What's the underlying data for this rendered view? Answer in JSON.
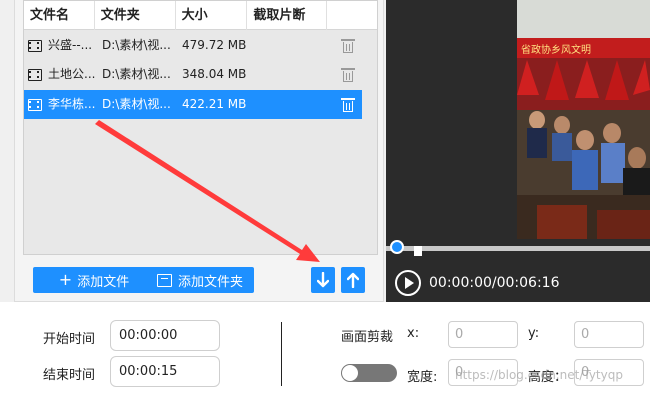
{
  "file_list": {
    "columns": [
      "文件名",
      "文件夹",
      "大小",
      "截取片断"
    ],
    "rows": [
      {
        "name": "兴盛--...",
        "folder": "D:\\素材\\视...",
        "size": "479.72 MB",
        "selected": false
      },
      {
        "name": "土地公...",
        "folder": "D:\\素材\\视...",
        "size": "348.04 MB",
        "selected": false
      },
      {
        "name": "李华栋...",
        "folder": "D:\\素材\\视...",
        "size": "422.21 MB",
        "selected": true
      }
    ]
  },
  "toolbar": {
    "add_file_label": "添加文件",
    "add_folder_label": "添加文件夹",
    "move_down_icon": "arrow-down",
    "move_up_icon": "arrow-up"
  },
  "player": {
    "time_display": "00:00:00/00:06:16"
  },
  "trim": {
    "start_label": "开始时间",
    "start_value": "00:00:00",
    "end_label": "结束时间",
    "end_value": "00:00:15"
  },
  "crop": {
    "label": "画面剪裁",
    "x_label": "x:",
    "x_value": "0",
    "y_label": "y:",
    "y_value": "0",
    "width_label": "宽度:",
    "width_value": "0",
    "height_label": "高度：",
    "height_value": "0",
    "toggle_on": false
  },
  "watermark": "https://blog.csdn.net/Tytyqp",
  "colors": {
    "accent": "#1e90ff",
    "annotation": "#ff4040"
  }
}
